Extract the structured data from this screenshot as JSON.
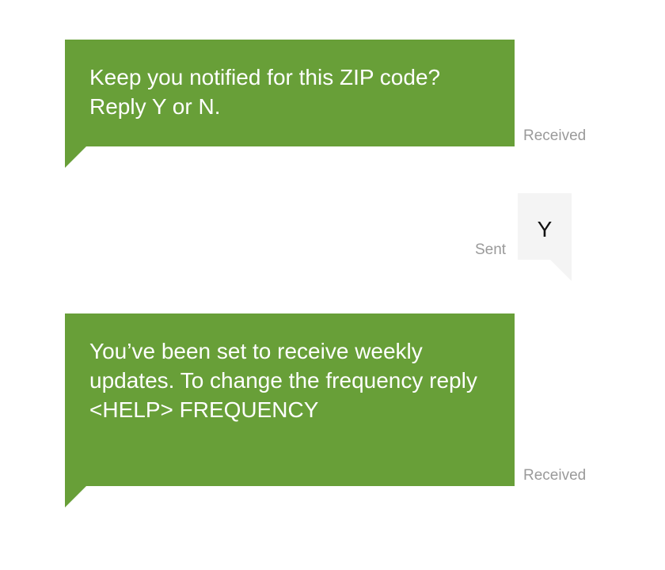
{
  "conversation": {
    "messages": [
      {
        "direction": "received",
        "text": "Keep you notified for this ZIP code? Reply Y or N.",
        "status": "Received"
      },
      {
        "direction": "sent",
        "text": "Y",
        "status": "Sent"
      },
      {
        "direction": "received",
        "text": "You’ve been set to receive weekly updates. To change the frequency reply <HELP> FREQUENCY",
        "status": "Received"
      }
    ]
  },
  "colors": {
    "received_bubble": "#689f38",
    "sent_bubble": "#f4f4f4",
    "status_text": "#9a9a9a",
    "received_text": "#ffffff",
    "sent_text": "#111111"
  }
}
